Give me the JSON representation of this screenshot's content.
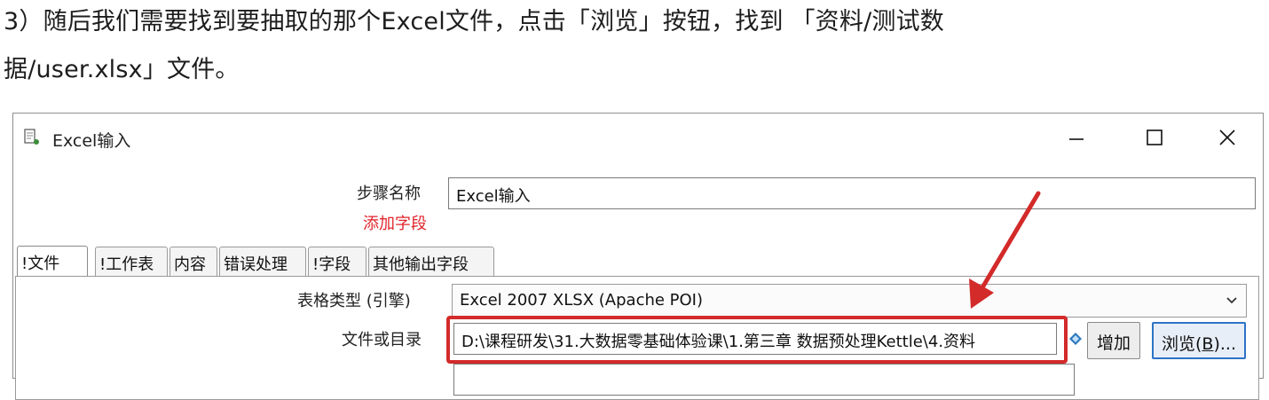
{
  "instructions": {
    "line1": "3）随后我们需要找到要抽取的那个Excel文件，点击「浏览」按钮，找到 「资料/测试数",
    "line2": "据/user.xlsx」文件。"
  },
  "window": {
    "title": "Excel输入",
    "controls": {
      "minimize": "minimize-icon",
      "maximize": "maximize-icon",
      "close": "close-icon"
    }
  },
  "form": {
    "step_name_label": "步骤名称",
    "step_name_value": "Excel输入",
    "add_field_label": "添加字段"
  },
  "tabs": [
    {
      "label": "!文件"
    },
    {
      "label": "!工作表"
    },
    {
      "label": "内容"
    },
    {
      "label": "错误处理"
    },
    {
      "label": "!字段"
    },
    {
      "label": "其他输出字段"
    }
  ],
  "file_tab": {
    "engine_label": "表格类型 (引擎)",
    "engine_value": "Excel 2007 XLSX (Apache POI)",
    "path_label": "文件或目录",
    "path_value": "D:\\课程研发\\31.大数据零基础体验课\\1.第三章 数据预处理Kettle\\4.资料",
    "add_button": "增加",
    "browse_button_prefix": "浏览(",
    "browse_button_key": "B",
    "browse_button_suffix": ")..."
  },
  "colors": {
    "highlight": "#d32a2a",
    "annotation_red": "#e0242b"
  }
}
